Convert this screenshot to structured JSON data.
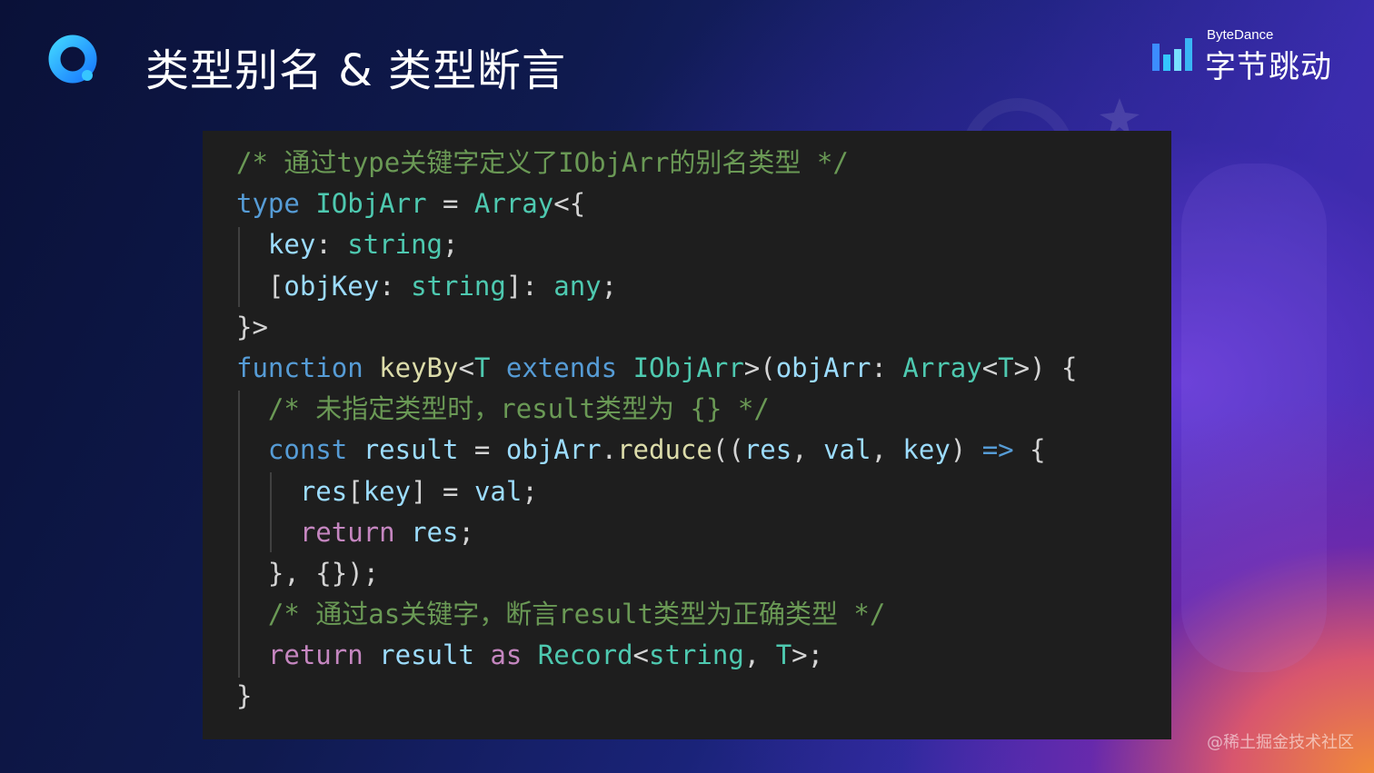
{
  "slide": {
    "title": "类型别名 & 类型断言",
    "brand_en": "ByteDance",
    "brand_cn": "字节跳动",
    "logo_icon": "q-ring-logo-icon",
    "brand_icon": "bytedance-bars-icon",
    "watermark": "@稀土掘金技术社区"
  },
  "colors": {
    "comment": "#6a9955",
    "keyword": "#569cd6",
    "control": "#c586c0",
    "type": "#4ec9b0",
    "variable": "#9cdcfe",
    "function": "#dcdcaa",
    "panel_bg": "#1e1e1e"
  },
  "code": {
    "lines": [
      [
        {
          "c": "cmt",
          "t": "/* 通过type关键字定义了IObjArr的别名类型 */"
        }
      ],
      [
        {
          "c": "kw",
          "t": "type"
        },
        {
          "c": "pun",
          "t": " "
        },
        {
          "c": "type",
          "t": "IObjArr"
        },
        {
          "c": "pun",
          "t": " = "
        },
        {
          "c": "type",
          "t": "Array"
        },
        {
          "c": "pun",
          "t": "<{"
        }
      ],
      [
        {
          "c": "pun",
          "t": "  "
        },
        {
          "c": "prop",
          "t": "key"
        },
        {
          "c": "pun",
          "t": ": "
        },
        {
          "c": "type",
          "t": "string"
        },
        {
          "c": "pun",
          "t": ";"
        }
      ],
      [
        {
          "c": "pun",
          "t": "  ["
        },
        {
          "c": "var",
          "t": "objKey"
        },
        {
          "c": "pun",
          "t": ": "
        },
        {
          "c": "type",
          "t": "string"
        },
        {
          "c": "pun",
          "t": "]: "
        },
        {
          "c": "type",
          "t": "any"
        },
        {
          "c": "pun",
          "t": ";"
        }
      ],
      [
        {
          "c": "pun",
          "t": "}>"
        }
      ],
      [
        {
          "c": "kw",
          "t": "function"
        },
        {
          "c": "pun",
          "t": " "
        },
        {
          "c": "fn",
          "t": "keyBy"
        },
        {
          "c": "pun",
          "t": "<"
        },
        {
          "c": "type",
          "t": "T"
        },
        {
          "c": "pun",
          "t": " "
        },
        {
          "c": "kw",
          "t": "extends"
        },
        {
          "c": "pun",
          "t": " "
        },
        {
          "c": "type",
          "t": "IObjArr"
        },
        {
          "c": "pun",
          "t": ">("
        },
        {
          "c": "var",
          "t": "objArr"
        },
        {
          "c": "pun",
          "t": ": "
        },
        {
          "c": "type",
          "t": "Array"
        },
        {
          "c": "pun",
          "t": "<"
        },
        {
          "c": "type",
          "t": "T"
        },
        {
          "c": "pun",
          "t": ">) {"
        }
      ],
      [
        {
          "c": "pun",
          "t": "  "
        },
        {
          "c": "cmt",
          "t": "/* 未指定类型时，result类型为 {} */"
        }
      ],
      [
        {
          "c": "pun",
          "t": "  "
        },
        {
          "c": "kw",
          "t": "const"
        },
        {
          "c": "pun",
          "t": " "
        },
        {
          "c": "var",
          "t": "result"
        },
        {
          "c": "pun",
          "t": " = "
        },
        {
          "c": "var",
          "t": "objArr"
        },
        {
          "c": "pun",
          "t": "."
        },
        {
          "c": "fn",
          "t": "reduce"
        },
        {
          "c": "pun",
          "t": "(("
        },
        {
          "c": "var",
          "t": "res"
        },
        {
          "c": "pun",
          "t": ", "
        },
        {
          "c": "var",
          "t": "val"
        },
        {
          "c": "pun",
          "t": ", "
        },
        {
          "c": "var",
          "t": "key"
        },
        {
          "c": "pun",
          "t": ") "
        },
        {
          "c": "kw",
          "t": "=>"
        },
        {
          "c": "pun",
          "t": " {"
        }
      ],
      [
        {
          "c": "pun",
          "t": "    "
        },
        {
          "c": "var",
          "t": "res"
        },
        {
          "c": "pun",
          "t": "["
        },
        {
          "c": "var",
          "t": "key"
        },
        {
          "c": "pun",
          "t": "] = "
        },
        {
          "c": "var",
          "t": "val"
        },
        {
          "c": "pun",
          "t": ";"
        }
      ],
      [
        {
          "c": "pun",
          "t": "    "
        },
        {
          "c": "ctl",
          "t": "return"
        },
        {
          "c": "pun",
          "t": " "
        },
        {
          "c": "var",
          "t": "res"
        },
        {
          "c": "pun",
          "t": ";"
        }
      ],
      [
        {
          "c": "pun",
          "t": "  }, {});"
        }
      ],
      [
        {
          "c": "pun",
          "t": "  "
        },
        {
          "c": "cmt",
          "t": "/* 通过as关键字，断言result类型为正确类型 */"
        }
      ],
      [
        {
          "c": "pun",
          "t": "  "
        },
        {
          "c": "ctl",
          "t": "return"
        },
        {
          "c": "pun",
          "t": " "
        },
        {
          "c": "var",
          "t": "result"
        },
        {
          "c": "pun",
          "t": " "
        },
        {
          "c": "ctl",
          "t": "as"
        },
        {
          "c": "pun",
          "t": " "
        },
        {
          "c": "type",
          "t": "Record"
        },
        {
          "c": "pun",
          "t": "<"
        },
        {
          "c": "type",
          "t": "string"
        },
        {
          "c": "pun",
          "t": ", "
        },
        {
          "c": "type",
          "t": "T"
        },
        {
          "c": "pun",
          "t": ">;"
        }
      ],
      [
        {
          "c": "pun",
          "t": "}"
        }
      ]
    ]
  }
}
